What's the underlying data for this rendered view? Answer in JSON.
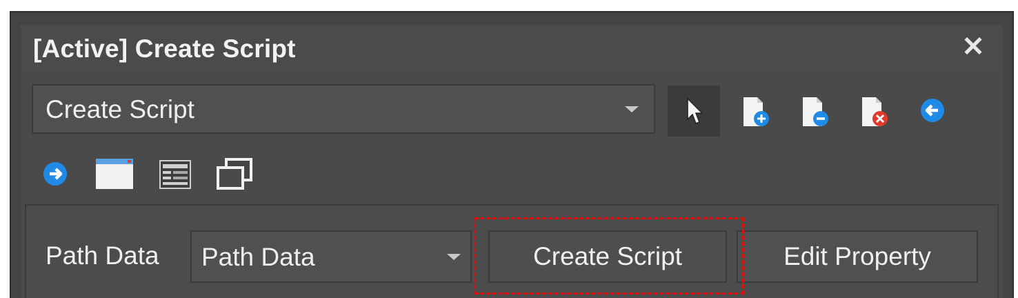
{
  "window": {
    "title": "[Active] Create Script",
    "close_glyph": "✕"
  },
  "toolbar": {
    "dropdown_value": "Create Script",
    "icons": [
      "pointer-icon",
      "add-page-icon",
      "remove-page-icon",
      "delete-page-icon",
      "back-arrow-icon",
      "forward-arrow-icon",
      "window-icon",
      "form-layout-icon",
      "stacked-windows-icon"
    ]
  },
  "form": {
    "path_label": "Path Data",
    "path_value": "Path Data",
    "create_button": "Create Script",
    "edit_button": "Edit Property"
  },
  "colors": {
    "background": "#444444",
    "text": "#f0f0f0",
    "accent_blue": "#2a8fe0",
    "highlight": "#e01010"
  }
}
